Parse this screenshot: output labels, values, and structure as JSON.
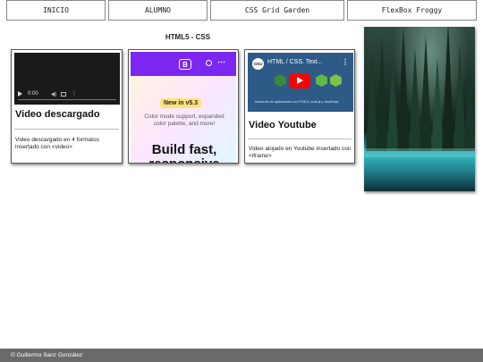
{
  "nav": {
    "items": [
      "INICIO",
      "ALUMNO",
      "CSS Grid Garden",
      "FlexBox Froggy"
    ]
  },
  "section_title": "HTML5 - CSS",
  "cards": [
    {
      "title": "Video descargado",
      "description": "Video descargado en 4 formatos insertado con <video>",
      "player": {
        "time": "0:00",
        "icons": [
          "play-icon",
          "volume-icon",
          "fullscreen-icon",
          "more-icon"
        ]
      }
    },
    {
      "embed": {
        "logo": "B",
        "badge": "New in v5.3",
        "subtitle": "Color mode support, expanded color palette, and more!",
        "headline": "Build fast, responsive",
        "brand_color": "#7c27f0"
      }
    },
    {
      "title": "Video Youtube",
      "description": "Video alojado en Youtube insertado con <iframe>",
      "youtube": {
        "channel": "GNU",
        "video_title": "HTML / CSS. Text...",
        "caption": "Desarrollo de aplicaciones con HTML5, node.js y JavaScript",
        "play_color": "#ff0000"
      }
    }
  ],
  "image": {
    "alt_icon": "forest-lake-image"
  },
  "footer": {
    "text": "© Guillermo Sanz González"
  }
}
